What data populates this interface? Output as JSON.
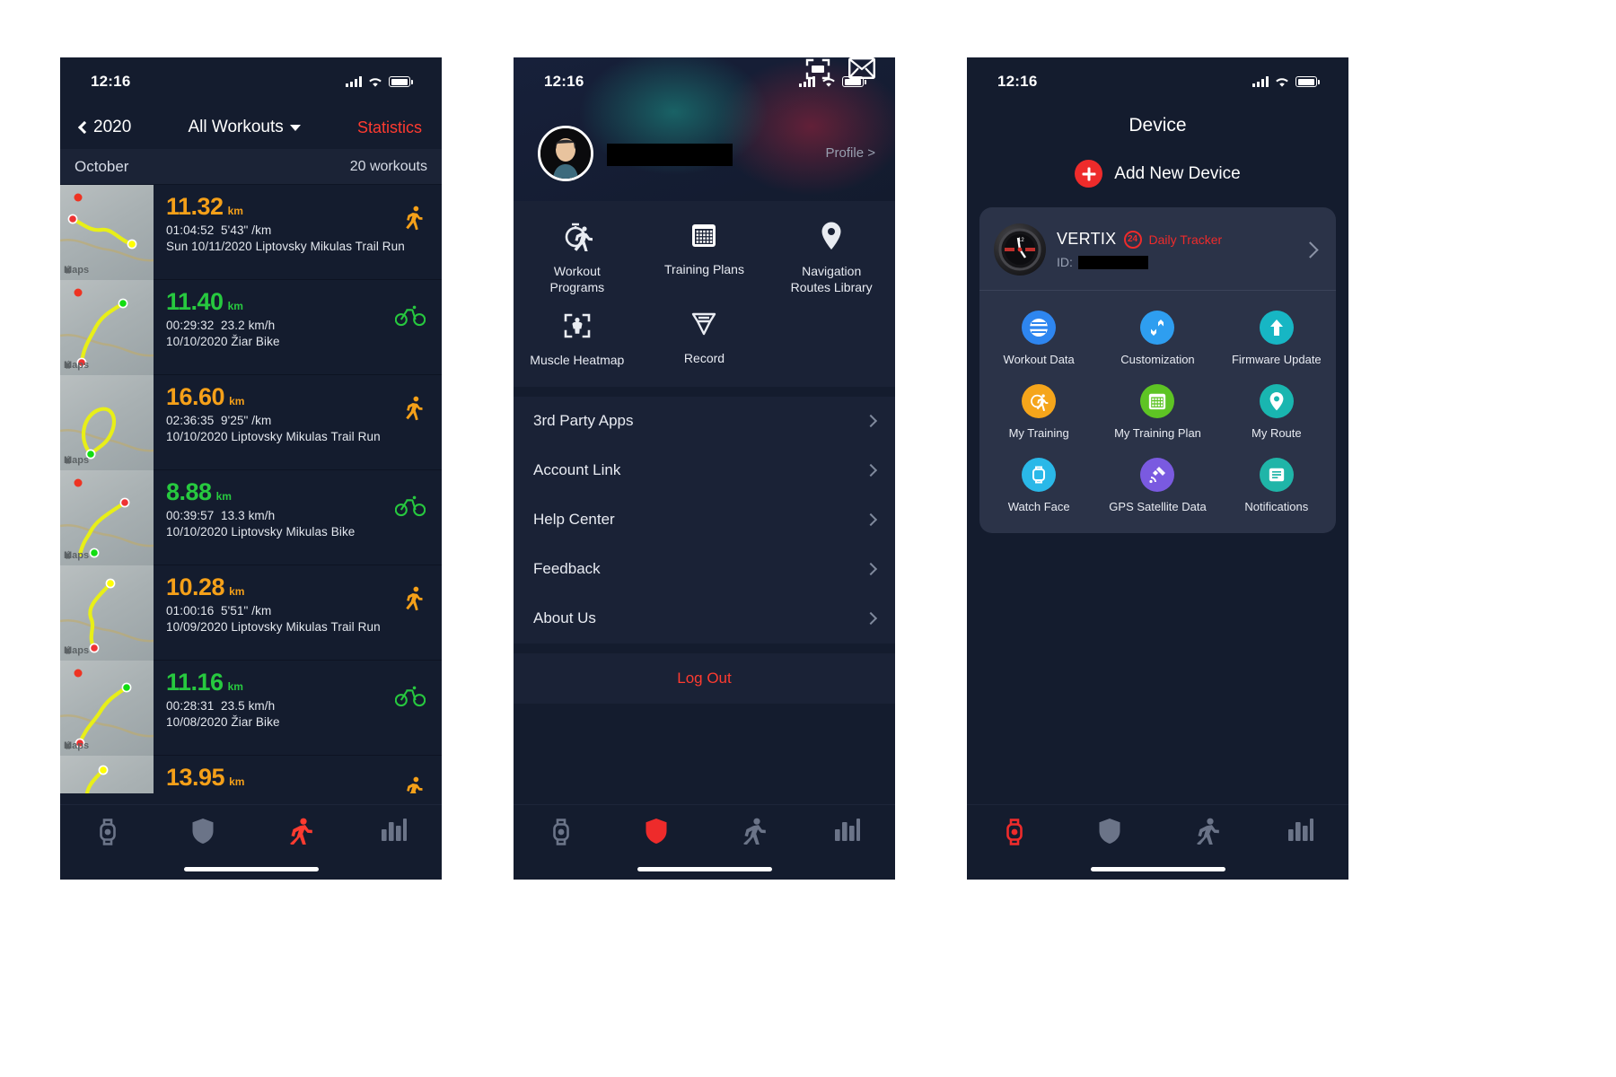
{
  "status_bar": {
    "time": "12:16"
  },
  "phone1": {
    "nav": {
      "back_label": "2020",
      "title": "All Workouts",
      "action_label": "Statistics"
    },
    "section": {
      "month": "October",
      "count": "20 workouts"
    },
    "map_label": "Maps",
    "workouts": [
      {
        "distance": "11.32",
        "unit": "km",
        "color": "orange",
        "duration": "01:04:52",
        "pace": "5'43\" /km",
        "title": "Sun 10/11/2020 Liptovsky Mikulas Trail Run",
        "sport": "run"
      },
      {
        "distance": "11.40",
        "unit": "km",
        "color": "green",
        "duration": "00:29:32",
        "pace": "23.2 km/h",
        "title": "10/10/2020 Žiar Bike",
        "sport": "bike"
      },
      {
        "distance": "16.60",
        "unit": "km",
        "color": "orange",
        "duration": "02:36:35",
        "pace": "9'25\" /km",
        "title": "10/10/2020 Liptovsky Mikulas Trail Run",
        "sport": "run"
      },
      {
        "distance": "8.88",
        "unit": "km",
        "color": "green",
        "duration": "00:39:57",
        "pace": "13.3 km/h",
        "title": "10/10/2020 Liptovsky Mikulas Bike",
        "sport": "bike"
      },
      {
        "distance": "10.28",
        "unit": "km",
        "color": "orange",
        "duration": "01:00:16",
        "pace": "5'51\" /km",
        "title": "10/09/2020 Liptovsky Mikulas Trail Run",
        "sport": "run"
      },
      {
        "distance": "11.16",
        "unit": "km",
        "color": "green",
        "duration": "00:28:31",
        "pace": "23.5 km/h",
        "title": "10/08/2020 Žiar Bike",
        "sport": "bike"
      },
      {
        "distance": "13.95",
        "unit": "km",
        "color": "orange",
        "duration": "",
        "pace": "",
        "title": "",
        "sport": "run"
      }
    ],
    "tabs": [
      {
        "icon": "chart-bars-icon",
        "active": false
      },
      {
        "icon": "running-person-icon",
        "active": true
      },
      {
        "icon": "shield-icon",
        "active": false
      },
      {
        "icon": "watch-icon",
        "active": false
      }
    ]
  },
  "phone2": {
    "header": {
      "profile_link": "Profile >",
      "scan_icon": "scan-code-icon",
      "mail_icon": "envelope-icon",
      "avatar": "avatar"
    },
    "grid": [
      {
        "label": "Workout\nPrograms",
        "icon": "workout-programs-icon"
      },
      {
        "label": "Training Plans",
        "icon": "calendar-icon"
      },
      {
        "label": "Navigation\nRoutes Library",
        "icon": "location-pin-icon"
      },
      {
        "label": "Muscle Heatmap",
        "icon": "muscle-heatmap-icon"
      },
      {
        "label": "Record",
        "icon": "medal-icon"
      }
    ],
    "menu": [
      {
        "label": "3rd Party Apps"
      },
      {
        "label": "Account Link"
      },
      {
        "label": "Help Center"
      },
      {
        "label": "Feedback"
      },
      {
        "label": "About Us"
      }
    ],
    "logout_label": "Log Out",
    "tabs": [
      {
        "icon": "chart-bars-icon",
        "active": false
      },
      {
        "icon": "running-person-icon",
        "active": false
      },
      {
        "icon": "shield-icon",
        "active": true
      },
      {
        "icon": "watch-icon",
        "active": false
      }
    ]
  },
  "phone3": {
    "title": "Device",
    "add_device_label": "Add New Device",
    "device": {
      "name": "VERTIX",
      "badge": "24",
      "badge_label": "Daily Tracker",
      "id_label": "ID:"
    },
    "grid": [
      {
        "label": "Workout Data",
        "icon": "workout-data-icon",
        "color": "#2e86f0"
      },
      {
        "label": "Customization",
        "icon": "customization-icon",
        "color": "#2e9ef0"
      },
      {
        "label": "Firmware Update",
        "icon": "firmware-update-icon",
        "color": "#17b6c4"
      },
      {
        "label": "My Training",
        "icon": "my-training-icon",
        "color": "#f5a51b"
      },
      {
        "label": "My Training Plan",
        "icon": "my-training-plan-icon",
        "color": "#5ec424"
      },
      {
        "label": "My Route",
        "icon": "my-route-icon",
        "color": "#19b6b0"
      },
      {
        "label": "Watch Face",
        "icon": "watch-face-icon",
        "color": "#2ab8e8"
      },
      {
        "label": "GPS Satellite Data",
        "icon": "gps-satellite-icon",
        "color": "#7a5ae0"
      },
      {
        "label": "Notifications",
        "icon": "notifications-icon",
        "color": "#1fb5a8"
      }
    ],
    "tabs": [
      {
        "icon": "chart-bars-icon",
        "active": false
      },
      {
        "icon": "running-person-icon",
        "active": false
      },
      {
        "icon": "shield-icon",
        "active": false
      },
      {
        "icon": "watch-icon",
        "active": true
      }
    ]
  },
  "colors": {
    "accent_red": "#ff3b30",
    "orange": "#f5a019",
    "green": "#27c93f",
    "bg": "#141c2e",
    "card": "#1a2236"
  }
}
